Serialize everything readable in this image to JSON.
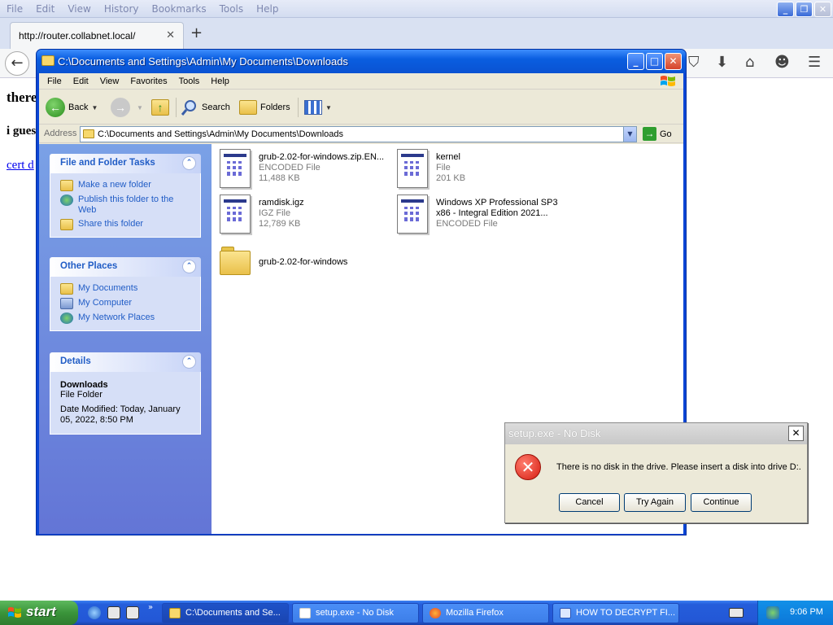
{
  "firefox": {
    "menu": [
      "File",
      "Edit",
      "View",
      "History",
      "Bookmarks",
      "Tools",
      "Help"
    ],
    "tab_title": "http://router.collabnet.local/",
    "page_line1": "there",
    "page_line2": "i gues",
    "page_link": "cert d"
  },
  "explorer": {
    "title": "C:\\Documents and Settings\\Admin\\My Documents\\Downloads",
    "menu": [
      "File",
      "Edit",
      "View",
      "Favorites",
      "Tools",
      "Help"
    ],
    "toolbar": {
      "back": "Back",
      "search": "Search",
      "folders": "Folders"
    },
    "address": {
      "label": "Address",
      "value": "C:\\Documents and Settings\\Admin\\My Documents\\Downloads",
      "go": "Go"
    },
    "panels": {
      "tasks": {
        "title": "File and Folder Tasks",
        "items": [
          "Make a new folder",
          "Publish this folder to the Web",
          "Share this folder"
        ]
      },
      "places": {
        "title": "Other Places",
        "items": [
          "My Documents",
          "My Computer",
          "My Network Places"
        ]
      },
      "details": {
        "title": "Details",
        "name": "Downloads",
        "type": "File Folder",
        "modified_1": "Date Modified: Today, January",
        "modified_2": "05, 2022, 8:50 PM"
      }
    },
    "files": [
      {
        "name": "grub-2.02-for-windows.zip.EN...",
        "type": "ENCODED File",
        "size": "11,488 KB"
      },
      {
        "name": "kernel",
        "type": "File",
        "size": "201 KB"
      },
      {
        "name": "ramdisk.igz",
        "type": "IGZ File",
        "size": "12,789 KB"
      },
      {
        "name_1": "Windows XP Professional SP3",
        "name_2": "x86 - Integral Edition 2021...",
        "type": "ENCODED File"
      },
      {
        "name": "grub-2.02-for-windows"
      }
    ]
  },
  "dialog": {
    "title": "setup.exe - No Disk",
    "message": "There is no disk in the drive. Please insert a disk into drive D:.",
    "buttons": {
      "cancel": "Cancel",
      "try_again": "Try Again",
      "continue": "Continue"
    }
  },
  "taskbar": {
    "start": "start",
    "tasks": [
      "C:\\Documents and Se...",
      "setup.exe - No Disk",
      "Mozilla Firefox",
      "HOW TO DECRYPT FI..."
    ],
    "time": "9:06 PM"
  }
}
